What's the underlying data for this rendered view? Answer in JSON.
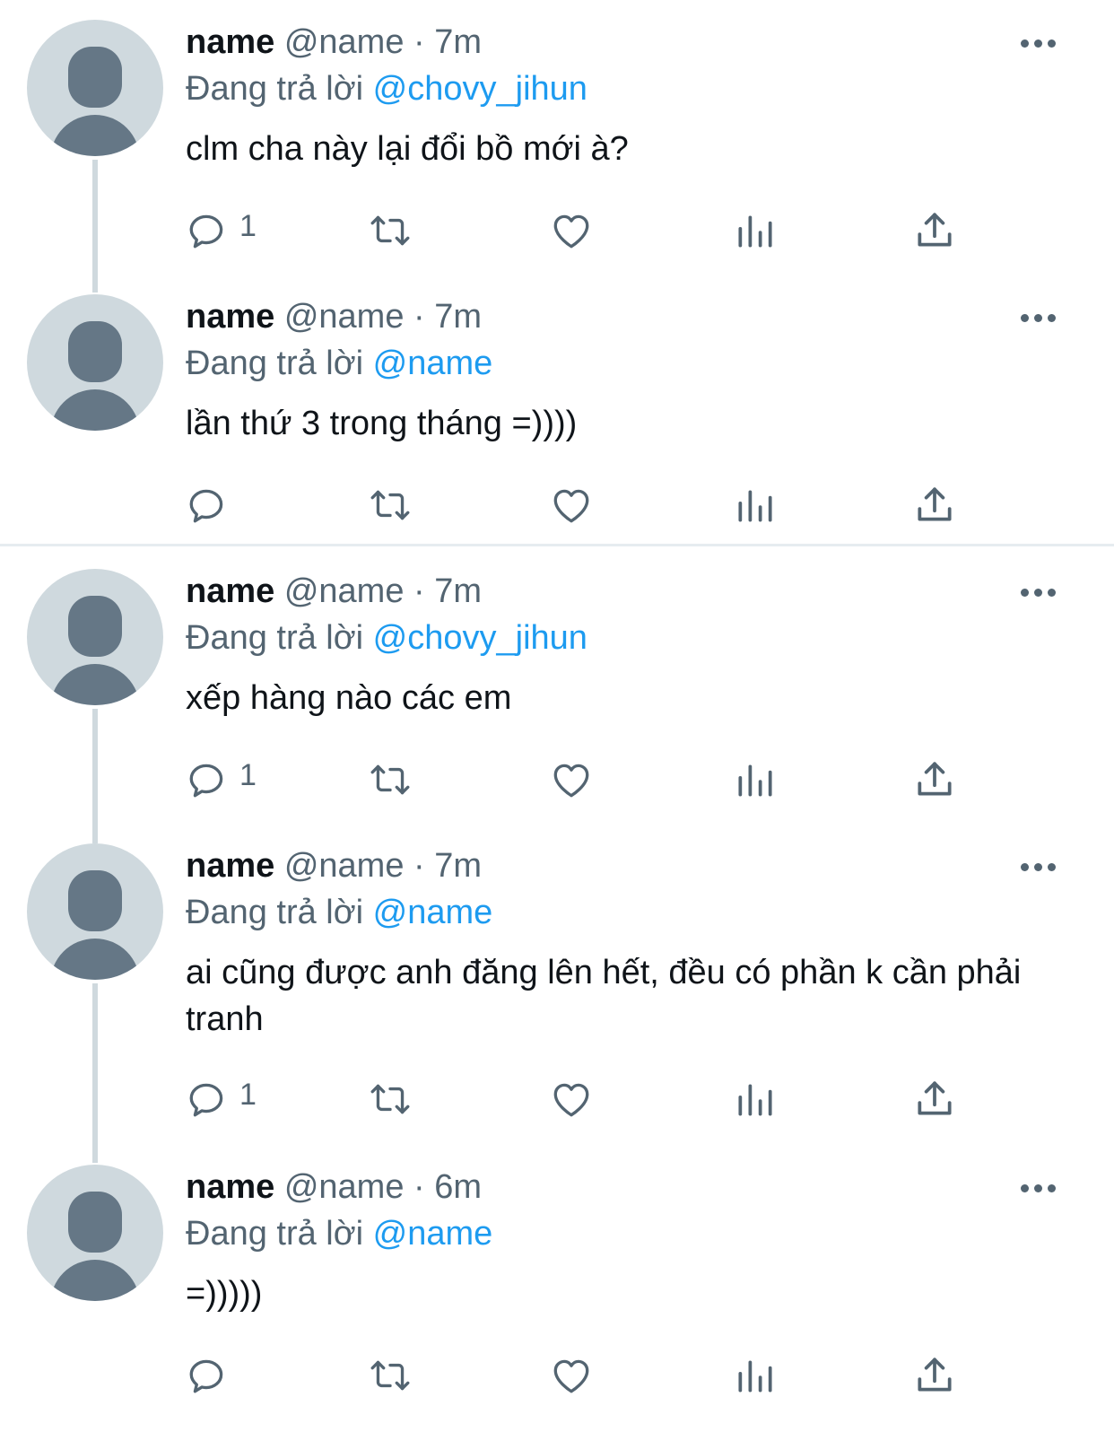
{
  "reply_prefix": "Đang trả lời",
  "tweets": [
    {
      "name": "name",
      "handle": "@name",
      "time": "· 7m",
      "reply_to": "@chovy_jihun",
      "text": "clm cha này lại đổi bồ mới à?",
      "reply_count": "1"
    },
    {
      "name": "name",
      "handle": "@name",
      "time": "· 7m",
      "reply_to": "@name",
      "text": "lần thứ 3 trong tháng =))))",
      "reply_count": ""
    },
    {
      "name": "name",
      "handle": "@name",
      "time": "· 7m",
      "reply_to": "@chovy_jihun",
      "text": "xếp hàng nào các em",
      "reply_count": "1"
    },
    {
      "name": "name",
      "handle": "@name",
      "time": "· 7m",
      "reply_to": "@name",
      "text": "ai cũng được anh đăng lên hết, đều có phần k cần phải tranh",
      "reply_count": "1"
    },
    {
      "name": "name",
      "handle": "@name",
      "time": "· 6m",
      "reply_to": "@name",
      "text": "=)))))",
      "reply_count": ""
    }
  ],
  "icons": {
    "reply": "reply-icon",
    "retweet": "retweet-icon",
    "like": "heart-icon",
    "views": "analytics-icon",
    "share": "share-icon",
    "more": "more-icon"
  },
  "colors": {
    "mention": "#1d9bf0",
    "secondary": "#536471",
    "avatar_bg": "#cfd9de",
    "avatar_fg": "#657786"
  }
}
